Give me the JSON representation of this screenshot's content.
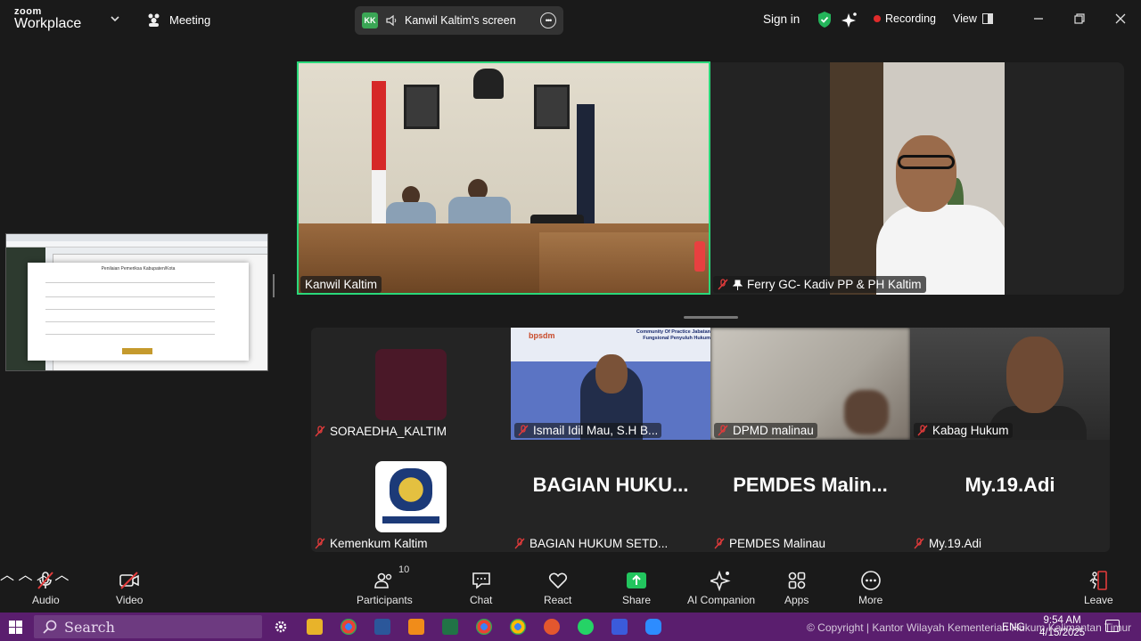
{
  "app": {
    "brand_top": "zoom",
    "brand_bottom": "Workplace"
  },
  "header": {
    "meeting_label": "Meeting",
    "screen_share": {
      "initials": "KK",
      "label": "Kanwil Kaltim's screen"
    },
    "sign_in": "Sign in",
    "recording": "Recording",
    "view": "View"
  },
  "participants": {
    "main": "Kanwil Kaltim",
    "pinned": "Ferry GC- Kadiv PP & PH Kaltim",
    "gallery": [
      {
        "name": "SORAEDHA_KALTIM"
      },
      {
        "name": "Ismail Idil Mau, S.H B..."
      },
      {
        "name": "DPMD malinau"
      },
      {
        "name": "Kabag Hukum"
      },
      {
        "name": "Kemenkum Kaltim"
      },
      {
        "name": "BAGIAN HUKUM SETD...",
        "display": "BAGIAN HUKU..."
      },
      {
        "name": "PEMDES Malinau",
        "display": "PEMDES Malin..."
      },
      {
        "name": "My.19.Adi",
        "display": "My.19.Adi"
      }
    ]
  },
  "shared_doc": {
    "title": "Penilaian Pemeriksa Kabupaten/Kota"
  },
  "ismail_banner": {
    "org": "bpsdm",
    "caption": "Community Of Practice Jabatan Fungsional Penyuluh Hukum"
  },
  "toolbar": {
    "audio": "Audio",
    "video": "Video",
    "participants": "Participants",
    "participants_count": "10",
    "chat": "Chat",
    "react": "React",
    "share": "Share",
    "ai": "AI Companion",
    "apps": "Apps",
    "more": "More",
    "leave": "Leave"
  },
  "taskbar": {
    "search": "Search",
    "copyright": "© Copyright | Kantor Wilayah Kementerian Hukum Kalimantan Timur",
    "lang": "ENG",
    "time": "9:54 AM",
    "date": "4/15/2025"
  },
  "colors": {
    "accent_green": "#2ad87a",
    "recording_red": "#e02b2b",
    "share_green": "#22c55e",
    "taskbar": "#5a1e6e"
  }
}
